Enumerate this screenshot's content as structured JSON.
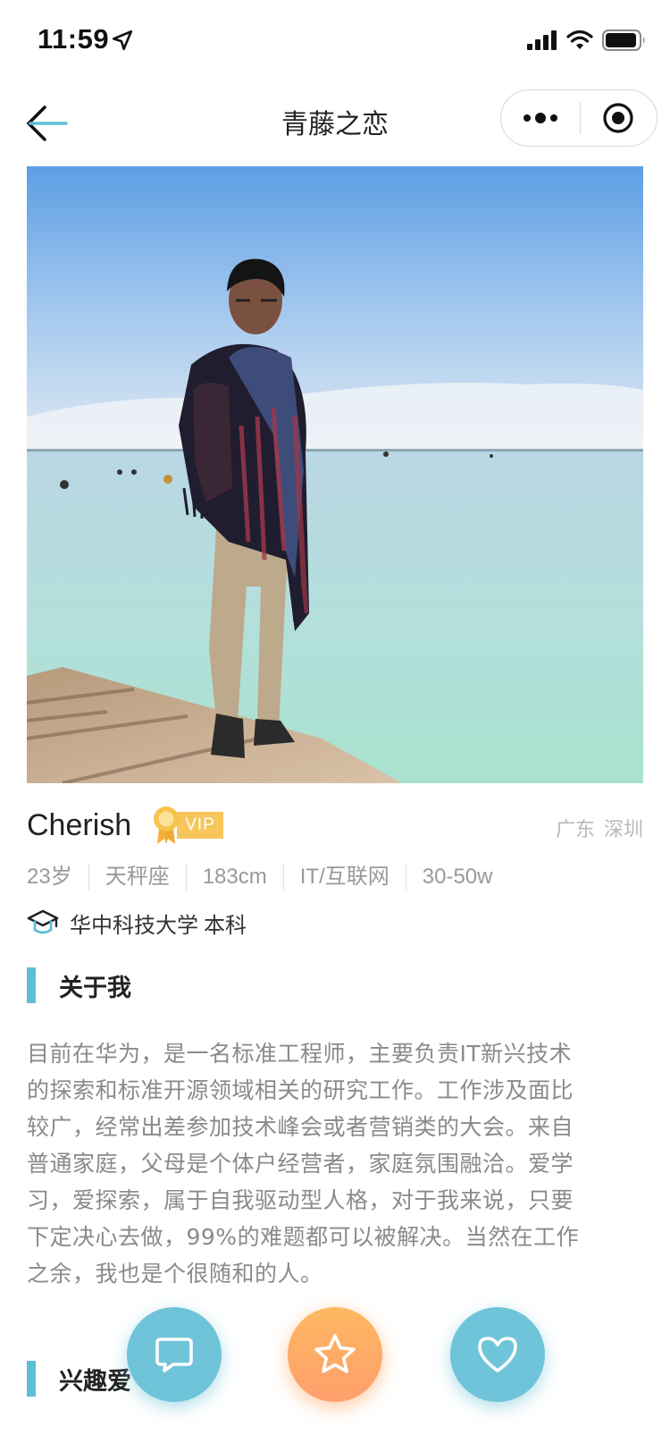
{
  "status_bar": {
    "time": "11:59",
    "location_icon": "location-arrow-icon",
    "signal_icon": "cellular-signal-icon",
    "wifi_icon": "wifi-icon",
    "battery_icon": "battery-icon"
  },
  "nav": {
    "title": "青藤之恋",
    "back_icon": "back-arrow-icon",
    "more_icon": "more-dots-icon",
    "close_icon": "target-close-icon"
  },
  "profile": {
    "photo_alt": "profile-photo",
    "name": "Cherish",
    "vip_label": "VIP",
    "location": {
      "province": "广东",
      "city": "深圳"
    },
    "tags": [
      "23岁",
      "天秤座",
      "183cm",
      "IT/互联网",
      "30-50w"
    ],
    "education": {
      "school": "华中科技大学",
      "degree": "本科",
      "icon": "graduation-cap-icon"
    }
  },
  "about": {
    "title": "关于我",
    "lines": [
      "目前在华为，是一名标准工程师，主要负责IT新兴技术",
      "的探索和标准开源领域相关的研究工作。工作涉及面比",
      "较广，经常出差参加技术峰会或者营销类的大会。来自",
      "普通家庭，父母是个体户经营者，家庭氛围融洽。爱学",
      "习，爱探索，属于自我驱动型人格，对于我来说，只要",
      "下定决心去做，99%的难题都可以被解决。当然在工作",
      "之余，我也是个很随和的人。"
    ]
  },
  "interests": {
    "title": "兴趣爱"
  },
  "actions": {
    "chat_icon": "chat-bubble-icon",
    "star_icon": "star-icon",
    "like_icon": "heart-icon"
  },
  "colors": {
    "accent": "#5bbfd6",
    "vip": "#f6c55c",
    "star_button": "#ffab66"
  }
}
